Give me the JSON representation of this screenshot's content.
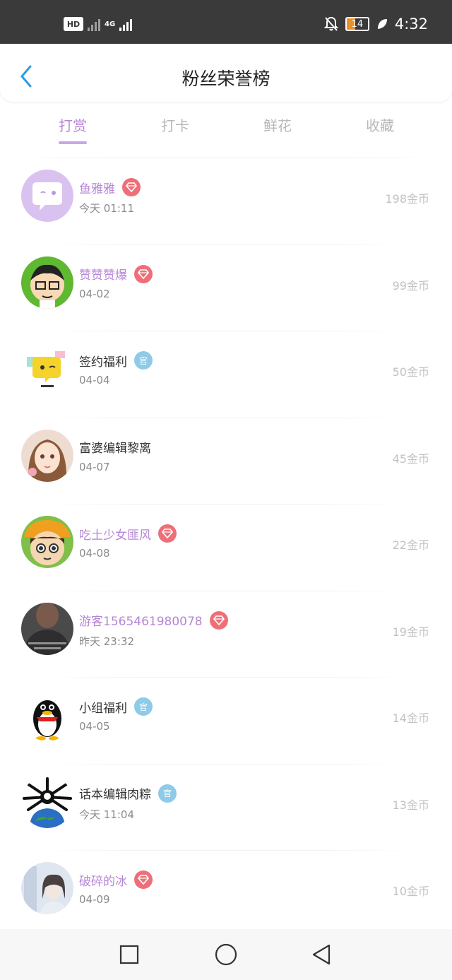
{
  "status_bar": {
    "hd_label": "HD",
    "network_label": "4G",
    "battery_level": "14",
    "time": "4:32"
  },
  "header": {
    "title": "粉丝荣誉榜"
  },
  "tabs": [
    {
      "label": "打赏",
      "active": true
    },
    {
      "label": "打卡",
      "active": false
    },
    {
      "label": "鲜花",
      "active": false
    },
    {
      "label": "收藏",
      "active": false
    }
  ],
  "colors": {
    "accent": "#b685d6",
    "diamond_badge": "#ef6f78",
    "official_badge": "#8ecbe8"
  },
  "fans": [
    {
      "name": "鱼雅雅",
      "date": "今天 01:11",
      "coins": "198金币",
      "badge": "diamond-icon",
      "vip": true
    },
    {
      "name": "赞赞赞爆",
      "date": "04-02",
      "coins": "99金币",
      "badge": "diamond-icon",
      "vip": true
    },
    {
      "name": "签约福利",
      "date": "04-04",
      "coins": "50金币",
      "badge": "official-icon",
      "badge_text": "官",
      "vip": false
    },
    {
      "name": "富婆编辑黎离",
      "date": "04-07",
      "coins": "45金币",
      "badge": "",
      "vip": false
    },
    {
      "name": "吃土少女匪风",
      "date": "04-08",
      "coins": "22金币",
      "badge": "diamond-icon",
      "vip": true
    },
    {
      "name": "游客1565461980078",
      "date": "昨天 23:32",
      "coins": "19金币",
      "badge": "diamond-icon",
      "vip": true
    },
    {
      "name": "小组福利",
      "date": "04-05",
      "coins": "14金币",
      "badge": "official-icon",
      "badge_text": "官",
      "vip": false
    },
    {
      "name": "话本编辑肉粽",
      "date": "今天 11:04",
      "coins": "13金币",
      "badge": "official-icon",
      "badge_text": "官",
      "vip": false
    },
    {
      "name": "破碎的冰",
      "date": "04-09",
      "coins": "10金币",
      "badge": "diamond-icon",
      "vip": true
    }
  ],
  "nav": {
    "buttons": [
      "square-icon",
      "circle-icon",
      "triangle-back-icon"
    ]
  }
}
